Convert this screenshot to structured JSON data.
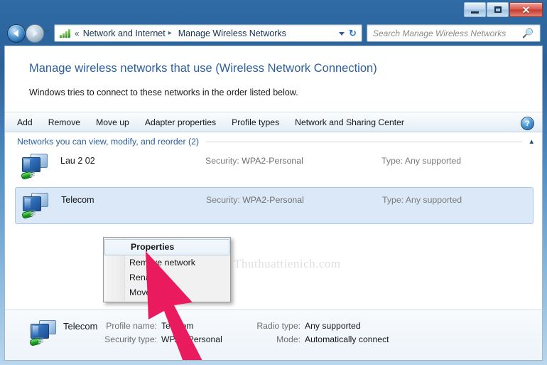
{
  "window": {
    "minimize_label": "Minimize",
    "maximize_label": "Maximize",
    "close_label": "Close"
  },
  "nav": {
    "back_label": "Back",
    "forward_label": "Forward",
    "recent_pages_label": "Recent pages",
    "breadcrumb": {
      "overflow": "«",
      "items": [
        "Network and Internet",
        "Manage Wireless Networks"
      ],
      "separator": "▸"
    },
    "refresh_label": "↻",
    "address_icon": "signal-bars-icon"
  },
  "search": {
    "placeholder": "Search Manage Wireless Networks",
    "icon": "search-icon"
  },
  "page": {
    "title": "Manage wireless networks that use (Wireless Network Connection)",
    "subtitle": "Windows tries to connect to these networks in the order listed below."
  },
  "toolbar": {
    "items": [
      "Add",
      "Remove",
      "Move up",
      "Adapter properties",
      "Profile types",
      "Network and Sharing Center"
    ],
    "help_label": "?"
  },
  "section": {
    "title": "Networks you can view, modify, and reorder (2)",
    "collapse_icon": "▴"
  },
  "networks": [
    {
      "name": "Lau 2 02",
      "security_label": "Security:",
      "security_value": "WPA2-Personal",
      "type_label": "Type:",
      "type_value": "Any supported",
      "selected": false
    },
    {
      "name": "Telecom",
      "security_label": "Security:",
      "security_value": "WPA2-Personal",
      "type_label": "Type:",
      "type_value": "Any supported",
      "selected": true
    }
  ],
  "context_menu": {
    "items": [
      {
        "label": "Properties",
        "highlighted": true
      },
      {
        "label": "Remove network",
        "highlighted": false
      },
      {
        "label": "Rename",
        "highlighted": false
      },
      {
        "label": "Move up",
        "highlighted": false
      }
    ]
  },
  "watermark": {
    "text": "Thuthuattienich.com"
  },
  "details": {
    "name": "Telecom",
    "profile_name_label": "Profile name:",
    "profile_name_value": "Telecom",
    "security_type_label": "Security type:",
    "security_type_value": "WPA2-Personal",
    "radio_type_label": "Radio type:",
    "radio_type_value": "Any supported",
    "mode_label": "Mode:",
    "mode_value": "Automatically connect"
  },
  "colors": {
    "accent_blue": "#2b5f9e",
    "selection_fill": "#dbe8f7",
    "selection_border": "#a8c8e6",
    "pointer_red": "#ea1a5f",
    "close_red": "#c33c2f"
  }
}
